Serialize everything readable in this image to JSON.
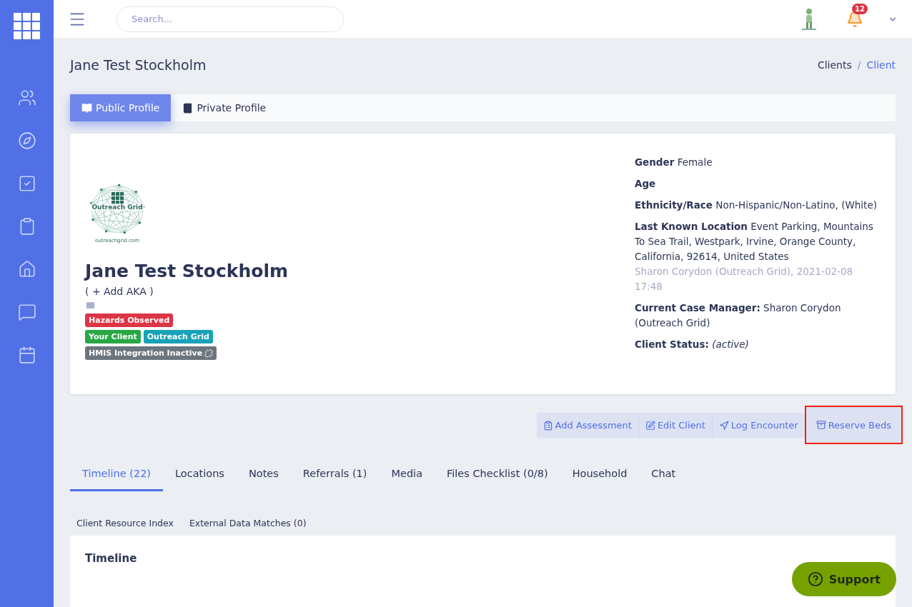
{
  "topbar": {
    "search": {
      "placeholder": "Search..."
    },
    "notifications": {
      "count": "12"
    }
  },
  "page": {
    "title": "Jane Test Stockholm",
    "breadcrumb": [
      {
        "label": "Clients",
        "selected": false
      },
      {
        "label": "Client",
        "selected": true
      }
    ],
    "breadcrumb_separator": "/"
  },
  "profile_tabs": [
    {
      "label": "Public Profile",
      "selected": true
    },
    {
      "label": "Private Profile",
      "selected": false
    }
  ],
  "profile": {
    "logo": {
      "name": "Outreach Grid",
      "url": "outreachgrid.com"
    },
    "name": "Jane Test Stockholm",
    "aka": "( + Add AKA )",
    "badge_rows": [
      [
        {
          "label": "Hazards Observed",
          "color": "#dc3545",
          "unlinked": false
        }
      ],
      [
        {
          "label": "Your Client",
          "color": "#28a745",
          "unlinked": false
        },
        {
          "label": "Outreach Grid",
          "color": "#17a2b8",
          "unlinked": false
        }
      ],
      [
        {
          "label": "HMIS Integration Inactive",
          "color": "#6c757d",
          "unlinked": true
        }
      ]
    ],
    "details": [
      {
        "label": "Gender",
        "value": "Female"
      },
      {
        "label": "Age"
      },
      {
        "label": "Ethnicity/Race",
        "value": "Non-Hispanic/Non-Latino, (White)"
      },
      {
        "label": "Last Known Location",
        "value": "Event Parking, Mountains To Sea Trail, Westpark, Irvine, Orange County, California, 92614, United States",
        "note": "Sharon Corydon (Outreach Grid), 2021-02-08 17:48"
      },
      {
        "label": "Current Case Manager:",
        "value": "Sharon Corydon (Outreach Grid)"
      },
      {
        "label": "Client Status:",
        "value": "(active)",
        "italic": true
      }
    ]
  },
  "actions": [
    {
      "kind": "assessment",
      "label": "Add Assessment",
      "highlighted": false
    },
    {
      "kind": "edit",
      "label": "Edit Client",
      "highlighted": false
    },
    {
      "kind": "encounter",
      "label": "Log Encounter",
      "highlighted": false
    },
    {
      "kind": "beds",
      "label": "Reserve Beds",
      "highlighted": true
    }
  ],
  "section_tabs": [
    {
      "label": "Timeline (22)",
      "selected": true
    },
    {
      "label": "Locations",
      "selected": false
    },
    {
      "label": "Notes",
      "selected": false
    },
    {
      "label": "Referrals (1)",
      "selected": false
    },
    {
      "label": "Media",
      "selected": false
    },
    {
      "label": "Files Checklist (0/8)",
      "selected": false
    },
    {
      "label": "Household",
      "selected": false
    },
    {
      "label": "Chat",
      "selected": false
    }
  ],
  "sub_links": [
    "Client Resource Index",
    "External Data Matches (0)"
  ],
  "timeline": {
    "title": "Timeline"
  },
  "support_button": {
    "label": "Support"
  }
}
